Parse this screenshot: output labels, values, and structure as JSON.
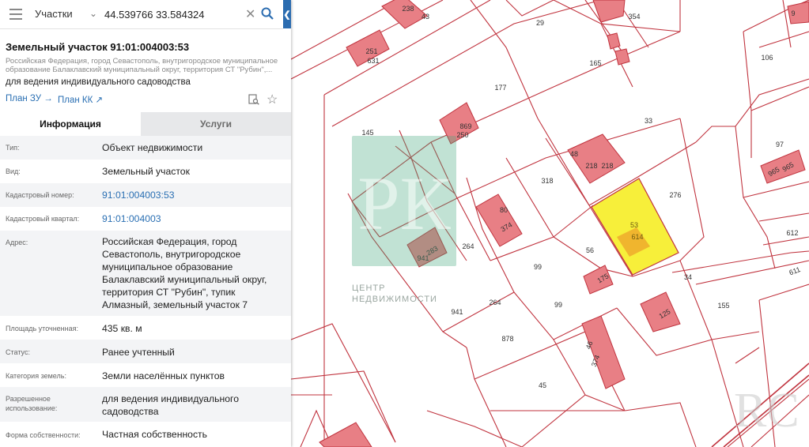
{
  "search": {
    "layer": "Участки",
    "query": "44.539766 33.584324"
  },
  "card": {
    "title": "Земельный участок 91:01:004003:53",
    "address_short": "Российская Федерация, город Севастополь, внутригородское муниципальное образование Балаклавский муниципальный округ, территория СТ \"Рубин\",...",
    "purpose": "для ведения индивидуального садоводства",
    "plan_zu": "План ЗУ",
    "plan_kk": "План КК",
    "arrow_zu": "→",
    "arrow_kk": "↗"
  },
  "tabs": {
    "info": "Информация",
    "services": "Услуги"
  },
  "info": [
    {
      "label": "Тип:",
      "value": "Объект недвижимости",
      "link": false
    },
    {
      "label": "Вид:",
      "value": "Земельный участок",
      "link": false
    },
    {
      "label": "Кадастровый номер:",
      "value": "91:01:004003:53",
      "link": true
    },
    {
      "label": "Кадастровый квартал:",
      "value": "91:01:004003",
      "link": true
    },
    {
      "label": "Адрес:",
      "value": "Российская Федерация, город Севастополь, внутригородское муниципальное образование Балаклавский муниципальный округ, территория СТ \"Рубин\", тупик Алмазный, земельный участок 7",
      "link": false
    },
    {
      "label": "Площадь уточненная:",
      "value": "435 кв. м",
      "link": false
    },
    {
      "label": "Статус:",
      "value": "Ранее учтенный",
      "link": false
    },
    {
      "label": "Категория земель:",
      "value": "Земли населённых пунктов",
      "link": false
    },
    {
      "label": "Разрешенное использование:",
      "value": "для ведения индивидуального садоводства",
      "link": false
    },
    {
      "label": "Форма собственности:",
      "value": "Частная собственность",
      "link": false
    }
  ],
  "map": {
    "parcel_labels": [
      "238",
      "43",
      "29",
      "354",
      "9",
      "251",
      "631",
      "165",
      "106",
      "177",
      "869",
      "250",
      "145",
      "33",
      "97",
      "48",
      "218",
      "218",
      "318",
      "276",
      "965",
      "965",
      "80",
      "374",
      "53",
      "614",
      "612",
      "283",
      "941",
      "264",
      "99",
      "56",
      "175",
      "611",
      "34",
      "155",
      "264",
      "99",
      "941",
      "125",
      "878",
      "46",
      "374",
      "45"
    ],
    "watermark_center": "ЦЕНТР НЕДВИЖИМОСТИ",
    "watermark_logo_letters": "РК",
    "watermark_corner_letters": "RC",
    "colors": {
      "boundary": "#c0333e",
      "building_fill": "#e87f85",
      "selected_fill": "#f7ef3a",
      "selected_building": "#f0b52e",
      "accent": "#2b6cb0",
      "watermark_green": "#48a97e"
    },
    "icons": [
      "menu-icon",
      "chevron-down-icon",
      "close-icon",
      "search-icon",
      "chevron-left-icon",
      "document-search-icon",
      "star-icon"
    ]
  }
}
